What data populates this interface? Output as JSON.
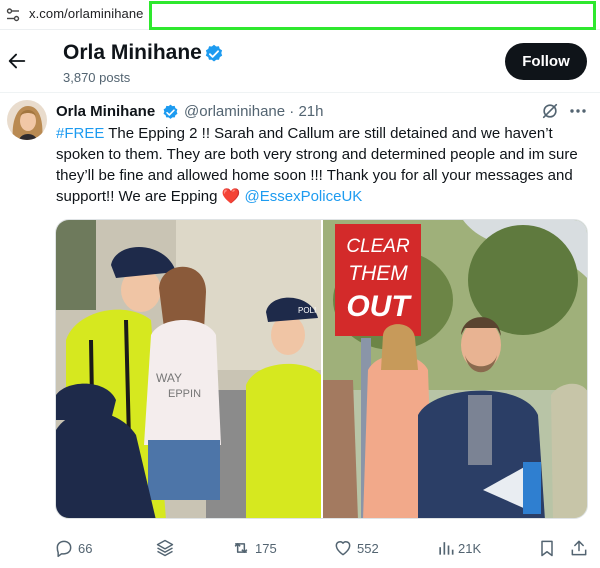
{
  "browser": {
    "url": "x.com/orlaminihane",
    "site_info_icon": "tune-icon",
    "highlight_color": "#2ee82e"
  },
  "header": {
    "name": "Orla Minihane",
    "posts_count": "3,870 posts",
    "follow_label": "Follow"
  },
  "tweet": {
    "author_name": "Orla Minihane",
    "handle": "@orlaminihane",
    "time": "· 21h",
    "hashtag": "#FREE",
    "body": " The Epping 2 !! Sarah and Callum are still detained and we haven’t spoken to them. They are both very strong and determined people and im sure they’ll be fine and allowed home soon !!! Thank you for all your messages and support!! We are Epping ",
    "heart": "❤️",
    "mention": "@EssexPoliceUK",
    "photo1": {
      "shirt_lines": [
        "WAY",
        "EPPIN"
      ],
      "police_badge": "POLI"
    },
    "photo2": {
      "placard_lines": [
        "CLEAR",
        "THEM",
        "OUT"
      ]
    },
    "stats": {
      "replies": "66",
      "retweets": "175",
      "likes": "552",
      "views": "21K"
    }
  },
  "colors": {
    "accent": "#1d9bf0",
    "text": "#0f1419",
    "secondary_text": "#536471",
    "follow_bg": "#0f1419",
    "heart": "#e0245e"
  }
}
